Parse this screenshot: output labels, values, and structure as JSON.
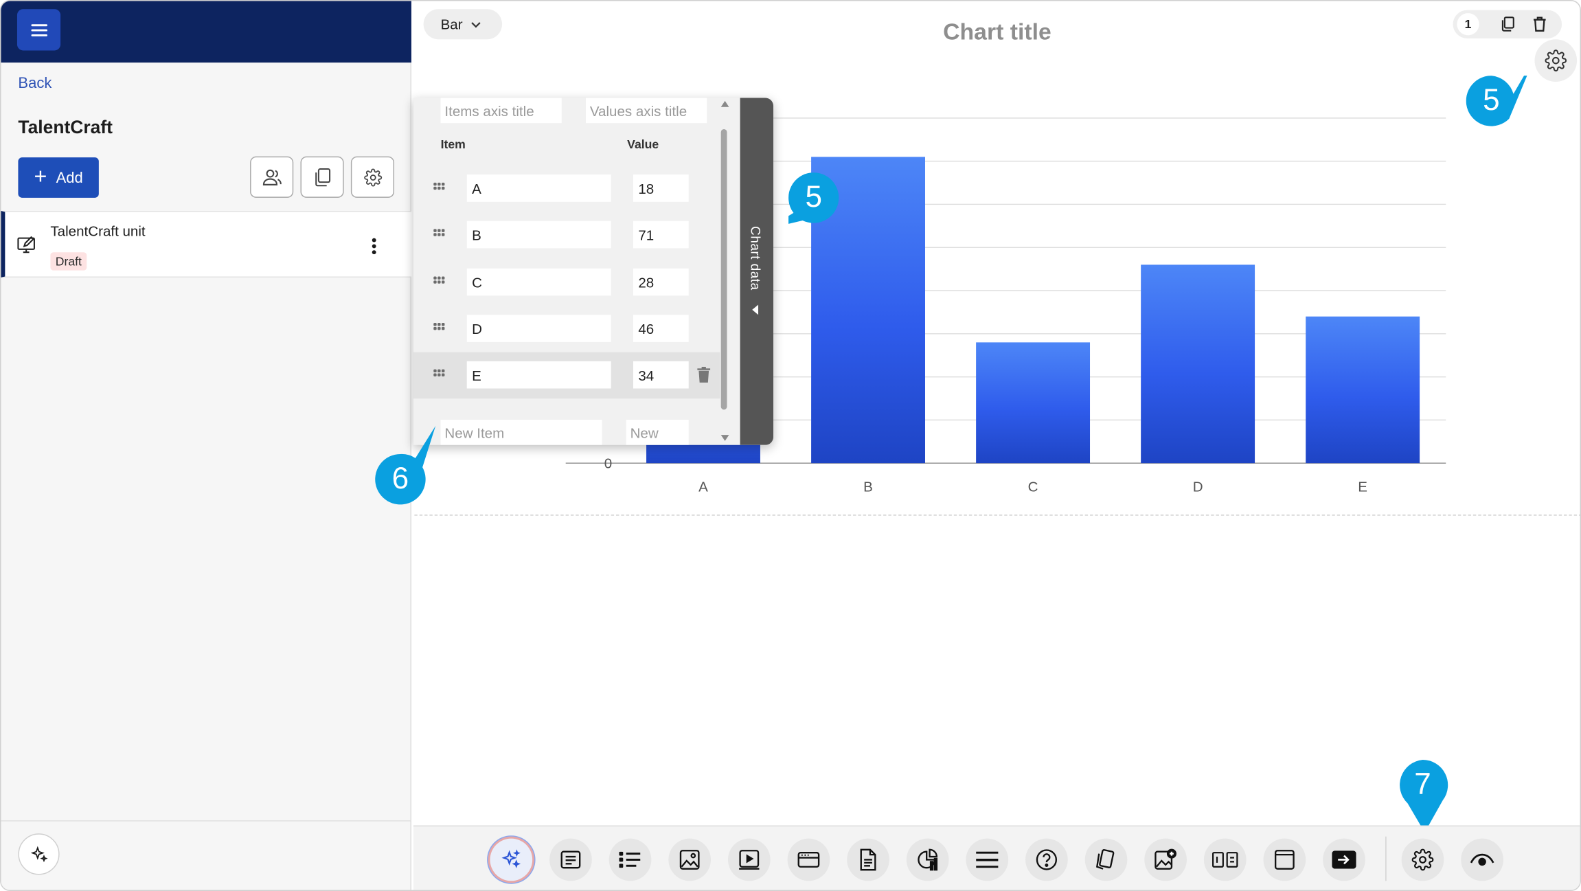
{
  "header": {
    "menu_icon": "hamburger-icon"
  },
  "sidebar": {
    "back_label": "Back",
    "course_title": "TalentCraft",
    "add_label": "Add",
    "tools": [
      "users-icon",
      "copy-icon",
      "gear-icon"
    ],
    "unit": {
      "name": "TalentCraft unit",
      "status": "Draft"
    },
    "ai_icon": "sparkle-icon"
  },
  "editor": {
    "chart_type": "Bar",
    "chart_title": "Chart title",
    "page_number": "1"
  },
  "data_panel": {
    "items_axis_placeholder": "Items axis title",
    "values_axis_placeholder": "Values axis title",
    "col_item": "Item",
    "col_value": "Value",
    "rows": [
      {
        "item": "A",
        "value": "18"
      },
      {
        "item": "B",
        "value": "71"
      },
      {
        "item": "C",
        "value": "28"
      },
      {
        "item": "D",
        "value": "46"
      },
      {
        "item": "E",
        "value": "34"
      }
    ],
    "new_item_placeholder": "New Item",
    "new_value_placeholder": "New",
    "tab_label": "Chart data"
  },
  "chart_data": {
    "type": "bar",
    "title": "Chart title",
    "categories": [
      "A",
      "B",
      "C",
      "D",
      "E"
    ],
    "values": [
      18,
      71,
      28,
      46,
      34
    ],
    "xlabel": "",
    "ylabel": "",
    "y_tick_labels_visible": [
      "0"
    ],
    "grid": true,
    "colors": {
      "bar_top": "#4d86f7",
      "bar_bottom": "#1e44c4"
    }
  },
  "callouts": [
    {
      "number": "5"
    },
    {
      "number": "5"
    },
    {
      "number": "6"
    },
    {
      "number": "7"
    }
  ],
  "toolbar": {
    "buttons": [
      "ai-sparkle-icon",
      "text-icon",
      "list-icon",
      "image-icon",
      "video-icon",
      "card-icon",
      "document-icon",
      "chart-icon",
      "divider-icon",
      "question-icon",
      "flashcard-icon",
      "image-hotspot-icon",
      "matching-icon",
      "frame-icon",
      "embed-icon",
      "settings-icon",
      "preview-icon"
    ]
  },
  "colors": {
    "navy": "#0d2460",
    "primary": "#1e4eb8",
    "callout": "#0aa0e0"
  }
}
